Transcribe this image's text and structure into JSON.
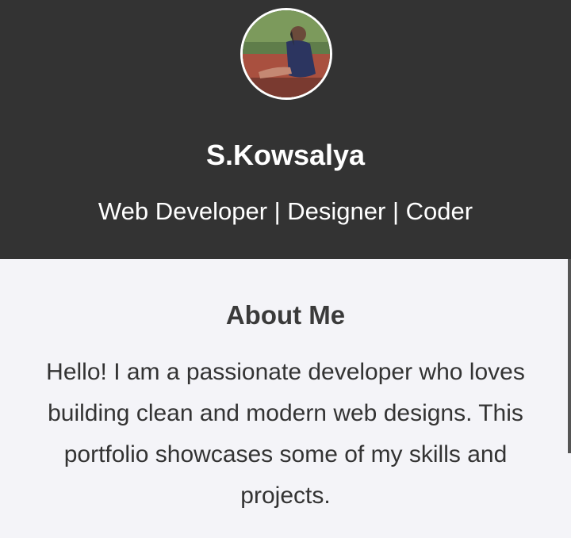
{
  "profile": {
    "avatar_alt": "profile photo",
    "name": "S.Kowsalya",
    "tagline": "Web Developer | Designer | Coder"
  },
  "about": {
    "heading": "About Me",
    "text": "Hello! I am a passionate developer who loves building clean and modern web designs. This portfolio showcases some of my skills and projects."
  },
  "colors": {
    "header_bg": "#333333",
    "page_bg": "#f4f4f8",
    "header_text": "#ffffff",
    "body_text": "#333333"
  }
}
